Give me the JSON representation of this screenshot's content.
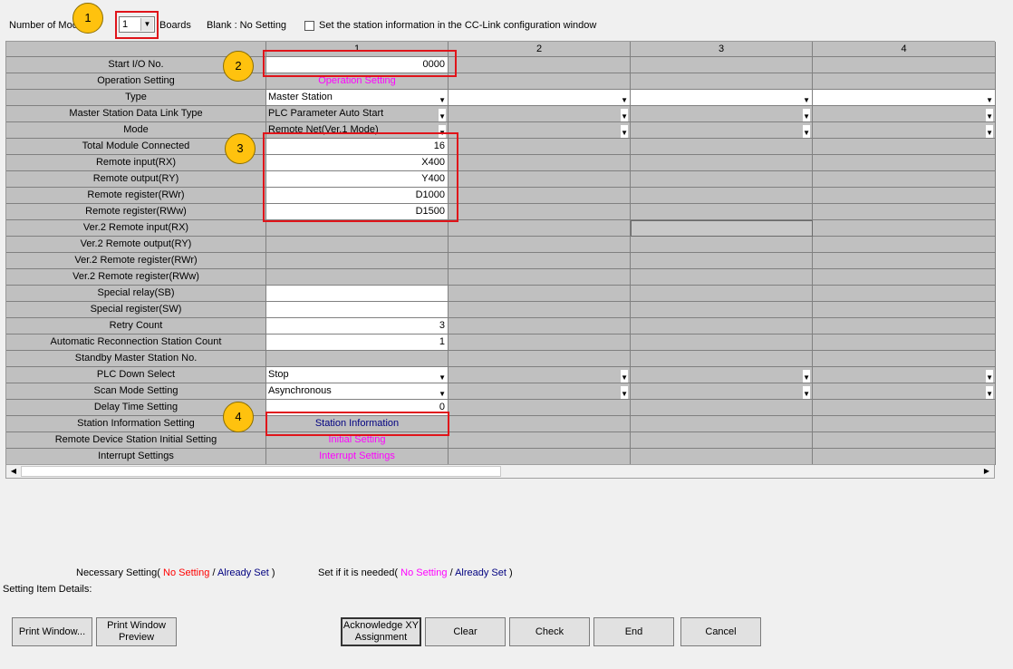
{
  "top": {
    "number_of_modules_label": "Number of Mod",
    "modules_value": "1",
    "boards_label": "Boards",
    "blank_label": "Blank : No Setting",
    "station_info_checkbox_label": "Set the station information in the CC-Link configuration window"
  },
  "columns": [
    "",
    "1",
    "2",
    "3",
    "4"
  ],
  "rows": [
    {
      "label": "Start I/O No.",
      "v1": "0000"
    },
    {
      "label": "Operation Setting",
      "v1": "Operation Setting"
    },
    {
      "label": "Type",
      "v1": "Master Station"
    },
    {
      "label": "Master Station Data Link Type",
      "v1": "PLC Parameter Auto Start"
    },
    {
      "label": "Mode",
      "v1": "Remote Net(Ver.1 Mode)"
    },
    {
      "label": "Total Module Connected",
      "v1": "16"
    },
    {
      "label": "Remote input(RX)",
      "v1": "X400"
    },
    {
      "label": "Remote output(RY)",
      "v1": "Y400"
    },
    {
      "label": "Remote register(RWr)",
      "v1": "D1000"
    },
    {
      "label": "Remote register(RWw)",
      "v1": "D1500"
    },
    {
      "label": "Ver.2 Remote input(RX)",
      "v1": ""
    },
    {
      "label": "Ver.2 Remote output(RY)",
      "v1": ""
    },
    {
      "label": "Ver.2 Remote register(RWr)",
      "v1": ""
    },
    {
      "label": "Ver.2 Remote register(RWw)",
      "v1": ""
    },
    {
      "label": "Special relay(SB)",
      "v1": ""
    },
    {
      "label": "Special register(SW)",
      "v1": ""
    },
    {
      "label": "Retry Count",
      "v1": "3"
    },
    {
      "label": "Automatic Reconnection Station Count",
      "v1": "1"
    },
    {
      "label": "Standby Master Station No.",
      "v1": ""
    },
    {
      "label": "PLC Down Select",
      "v1": "Stop"
    },
    {
      "label": "Scan Mode Setting",
      "v1": "Asynchronous"
    },
    {
      "label": "Delay Time Setting",
      "v1": "0"
    },
    {
      "label": "Station Information Setting",
      "v1": "Station Information"
    },
    {
      "label": "Remote Device Station Initial Setting",
      "v1": "Initial Setting"
    },
    {
      "label": "Interrupt Settings",
      "v1": "Interrupt Settings"
    }
  ],
  "legend": {
    "necessary": "Necessary Setting(",
    "no_setting": "No Setting",
    "slash": "/",
    "already_set": "Already Set",
    "close": ")",
    "if_needed": "Set if it is needed(",
    "no_setting2": "No Setting",
    "already_set2": "Already Set"
  },
  "details_label": "Setting Item Details:",
  "buttons": {
    "print_window": "Print Window...",
    "print_preview": "Print Window Preview",
    "ack_xy": "Acknowledge XY Assignment",
    "clear": "Clear",
    "check": "Check",
    "end": "End",
    "cancel": "Cancel"
  },
  "callouts": [
    "1",
    "2",
    "3",
    "4"
  ],
  "colors": {
    "callout": "#ffc20e",
    "highlight": "#e0141a",
    "magenta": "#ff00ff",
    "navy": "#000080"
  }
}
